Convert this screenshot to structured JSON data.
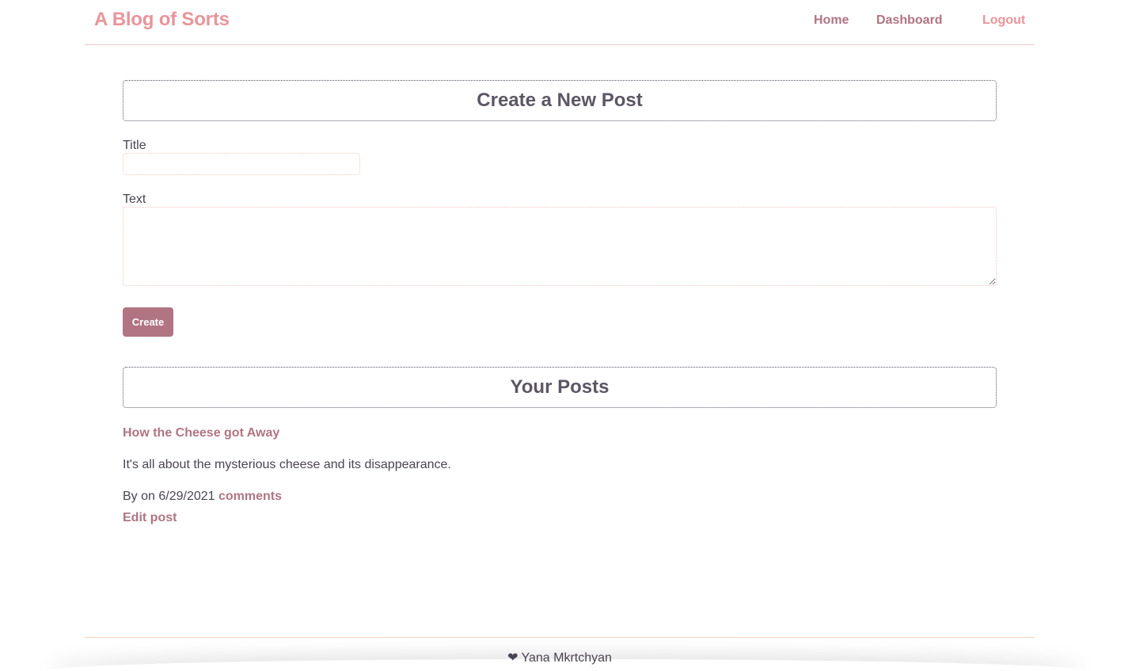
{
  "header": {
    "brand": "A Blog of Sorts",
    "nav": {
      "home": "Home",
      "dashboard": "Dashboard",
      "logout": "Logout"
    }
  },
  "create_post": {
    "heading": "Create a New Post",
    "title_label": "Title",
    "title_value": "",
    "text_label": "Text",
    "text_value": "",
    "create_button": "Create"
  },
  "your_posts": {
    "heading": "Your Posts",
    "posts": [
      {
        "title": "How the Cheese got Away",
        "body": "It's all about the mysterious cheese and its disappearance.",
        "meta": "By on 6/29/2021",
        "comments_link": "comments",
        "edit_link": "Edit post"
      }
    ]
  },
  "footer": {
    "heart": "❤",
    "author": "Yana Mkrtchyan"
  },
  "colors": {
    "brand": "#e8959a",
    "accent": "#b07483",
    "text": "#5c5665"
  }
}
